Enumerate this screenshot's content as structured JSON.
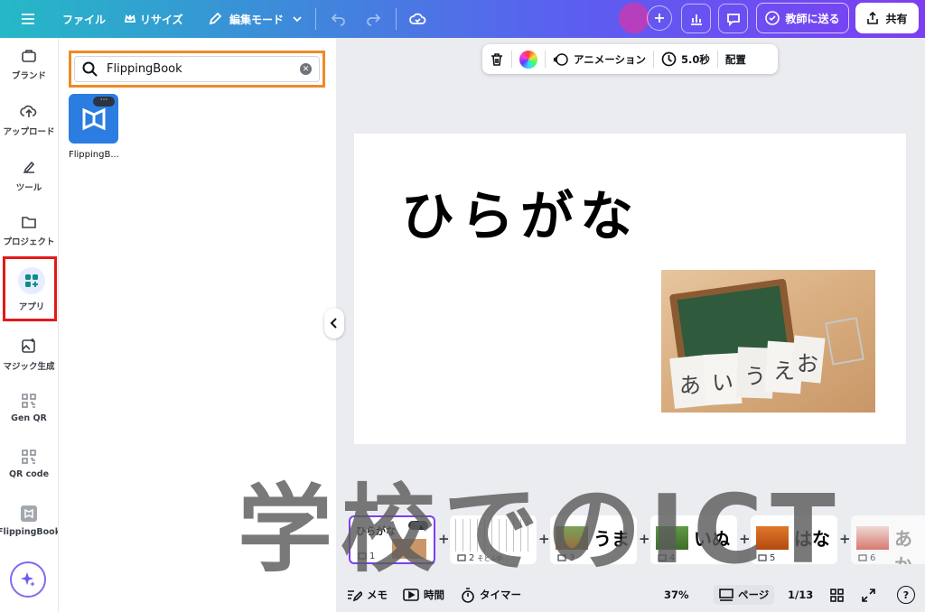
{
  "topbar": {
    "file_label": "ファイル",
    "resize_label": "リサイズ",
    "edit_mode_label": "編集モード",
    "send_to_teacher_label": "教師に送る",
    "share_label": "共有",
    "avatar_color": "#b63fbd"
  },
  "rail": {
    "items": [
      {
        "label": "ブランド",
        "icon": "brand-icon"
      },
      {
        "label": "アップロード",
        "icon": "cloud-upload-icon"
      },
      {
        "label": "ツール",
        "icon": "pen-tool-icon"
      },
      {
        "label": "プロジェクト",
        "icon": "folder-icon"
      },
      {
        "label": "アプリ",
        "icon": "apps-grid-icon"
      },
      {
        "label": "マジック生成",
        "icon": "magic-image-icon"
      },
      {
        "label": "Gen QR",
        "icon": "qr-icon"
      },
      {
        "label": "QR code",
        "icon": "qr-icon"
      },
      {
        "label": "FlippingBook",
        "icon": "flippingbook-icon"
      }
    ]
  },
  "panel": {
    "search_value": "FlippingBook",
    "app_label": "FlippingB...",
    "app_more": "···"
  },
  "float_toolbar": {
    "animation_label": "アニメーション",
    "duration_label": "5.0秒",
    "arrange_label": "配置"
  },
  "slide": {
    "title": "ひらがな",
    "cards": [
      "あ",
      "い",
      "う",
      "え",
      "お"
    ]
  },
  "filmstrip": {
    "thumbs": [
      {
        "num": "1",
        "word": "ひらがな"
      },
      {
        "num": "2",
        "word": "",
        "note": "そとふゆ"
      },
      {
        "num": "3",
        "word": "うま"
      },
      {
        "num": "4",
        "word": "いぬ"
      },
      {
        "num": "5",
        "word": "はな"
      },
      {
        "num": "6",
        "word": "あか"
      }
    ]
  },
  "watermark": "学校でのICT",
  "bottombar": {
    "notes_label": "メモ",
    "time_label": "時間",
    "timer_label": "タイマー",
    "zoom": "37%",
    "pages_label": "ページ",
    "page_indicator": "1/13",
    "help_label": "?"
  },
  "colors": {
    "apps_highlight": "#e31919",
    "search_highlight": "#f08a24",
    "app_tile": "#2b7de1",
    "selected_thumb": "#7d3ef2"
  }
}
